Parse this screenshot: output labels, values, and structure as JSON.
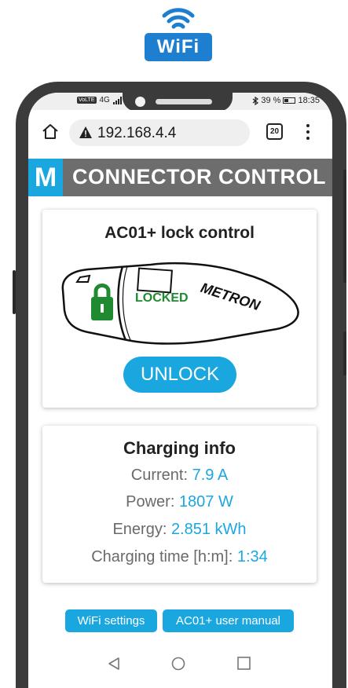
{
  "wifi_badge": {
    "label": "WiFi"
  },
  "status_bar": {
    "carrier_tag": "VoLTE",
    "network": "4G",
    "battery_percent": "39 %",
    "time": "18:35"
  },
  "browser": {
    "url": "192.168.4.4",
    "tab_count": "20"
  },
  "header": {
    "logo_letter": "M",
    "title": "CONNECTOR CONTROL"
  },
  "lock_card": {
    "title": "AC01+ lock control",
    "status": "LOCKED",
    "brand_on_plug": "METRON",
    "action_label": "UNLOCK"
  },
  "charging_card": {
    "title": "Charging info",
    "rows": [
      {
        "label": "Current: ",
        "value": "7.9 A"
      },
      {
        "label": "Power: ",
        "value": "1807 W"
      },
      {
        "label": "Energy: ",
        "value": "2.851 kWh"
      },
      {
        "label": "Charging time [h:m]: ",
        "value": "1:34"
      }
    ]
  },
  "footer": {
    "wifi_settings": "WiFi settings",
    "manual": "AC01+ user manual"
  },
  "colors": {
    "accent": "#1aa7e0",
    "header_bg": "#6d6d6d",
    "locked_green": "#1f8a30",
    "wifi_blue": "#1e7fd0"
  }
}
